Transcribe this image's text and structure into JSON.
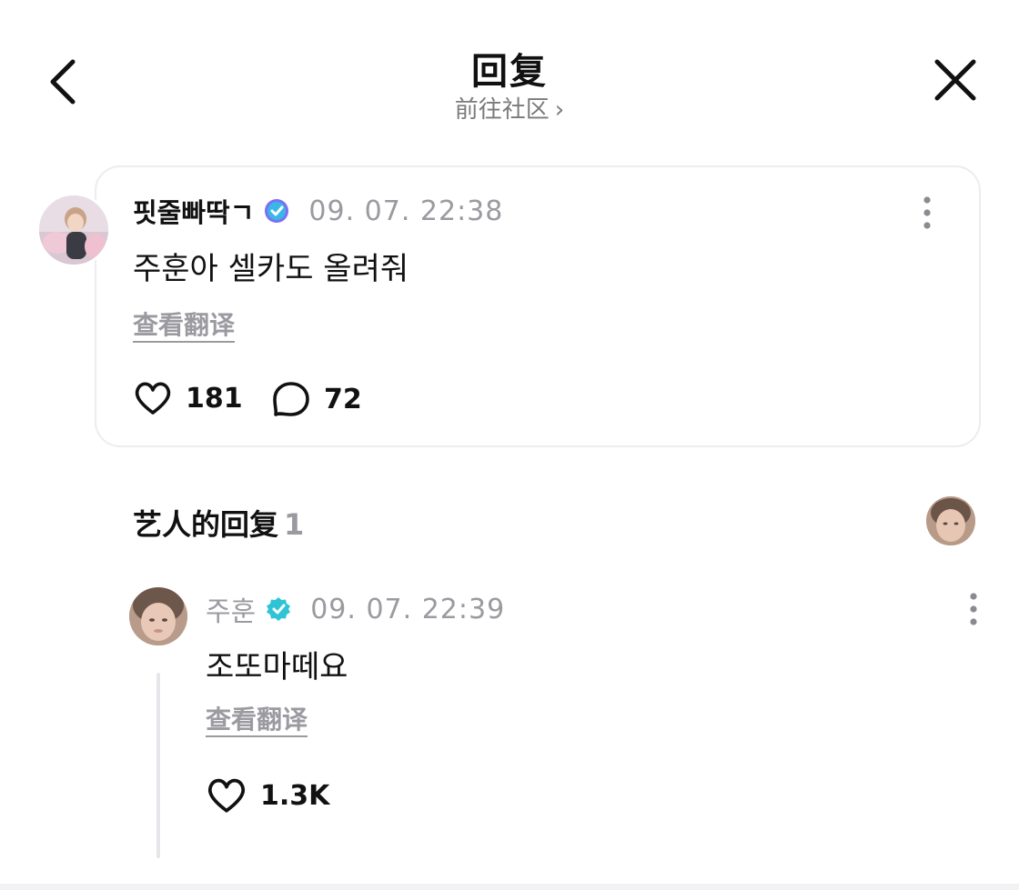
{
  "header": {
    "title": "回复",
    "community_link": "前往社区",
    "back_icon": "chevron-left-icon",
    "close_icon": "close-icon"
  },
  "post": {
    "username": "핏줄빠딱ㄱ",
    "verified_color": "#6c63ff",
    "timestamp": "09. 07. 22:38",
    "text": "주훈아 셀카도 올려줘",
    "translate_label": "查看翻译",
    "likes": "181",
    "comments": "72"
  },
  "artist_replies": {
    "title": "艺人的回复",
    "count": "1"
  },
  "reply": {
    "username": "주훈",
    "verified_color": "#2ec4d6",
    "timestamp": "09. 07. 22:39",
    "text": "조또마떼요",
    "translate_label": "查看翻译",
    "likes": "1.3K"
  }
}
